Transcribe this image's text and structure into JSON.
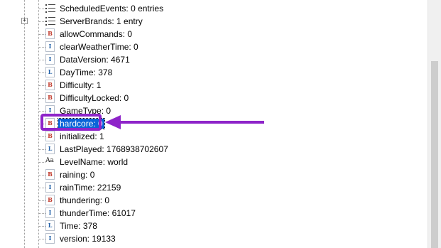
{
  "tree": {
    "rows": [
      {
        "icon": "list",
        "icon_name": "list-icon",
        "label": "ScheduledEvents: 0 entries",
        "expander": false
      },
      {
        "icon": "list",
        "icon_name": "list-icon",
        "label": "ServerBrands: 1 entry",
        "expander": true
      },
      {
        "icon": "b",
        "glyph": "B",
        "icon_name": "byte-tag-icon",
        "label": "allowCommands: 0"
      },
      {
        "icon": "i",
        "glyph": "I",
        "icon_name": "int-tag-icon",
        "label": "clearWeatherTime: 0"
      },
      {
        "icon": "i",
        "glyph": "I",
        "icon_name": "int-tag-icon",
        "label": "DataVersion: 4671"
      },
      {
        "icon": "l",
        "glyph": "L",
        "icon_name": "long-tag-icon",
        "label": "DayTime: 378"
      },
      {
        "icon": "b",
        "glyph": "B",
        "icon_name": "byte-tag-icon",
        "label": "Difficulty: 1"
      },
      {
        "icon": "b",
        "glyph": "B",
        "icon_name": "byte-tag-icon",
        "label": "DifficultyLocked: 0"
      },
      {
        "icon": "i",
        "glyph": "I",
        "icon_name": "int-tag-icon",
        "label": "GameType: 0"
      },
      {
        "icon": "b",
        "glyph": "B",
        "icon_name": "byte-tag-icon",
        "label": "hardcore: 0",
        "selected": true
      },
      {
        "icon": "b",
        "glyph": "B",
        "icon_name": "byte-tag-icon",
        "label": "initialized: 1"
      },
      {
        "icon": "l",
        "glyph": "L",
        "icon_name": "long-tag-icon",
        "label": "LastPlayed: 1768938702607"
      },
      {
        "icon": "s",
        "glyph": "Aa",
        "icon_name": "string-tag-icon",
        "label": "LevelName: world"
      },
      {
        "icon": "b",
        "glyph": "B",
        "icon_name": "byte-tag-icon",
        "label": "raining: 0"
      },
      {
        "icon": "i",
        "glyph": "I",
        "icon_name": "int-tag-icon",
        "label": "rainTime: 22159"
      },
      {
        "icon": "b",
        "glyph": "B",
        "icon_name": "byte-tag-icon",
        "label": "thundering: 0"
      },
      {
        "icon": "i",
        "glyph": "I",
        "icon_name": "int-tag-icon",
        "label": "thunderTime: 61017"
      },
      {
        "icon": "l",
        "glyph": "L",
        "icon_name": "long-tag-icon",
        "label": "Time: 378"
      },
      {
        "icon": "i",
        "glyph": "I",
        "icon_name": "int-tag-icon",
        "label": "version: 19133"
      }
    ],
    "expand_glyph": "+"
  },
  "annotation": {
    "color": "#8e24c9"
  },
  "colors": {
    "selection": "#0a64d8",
    "byte_icon": "#c0392b",
    "int_icon": "#1f5fa8"
  }
}
